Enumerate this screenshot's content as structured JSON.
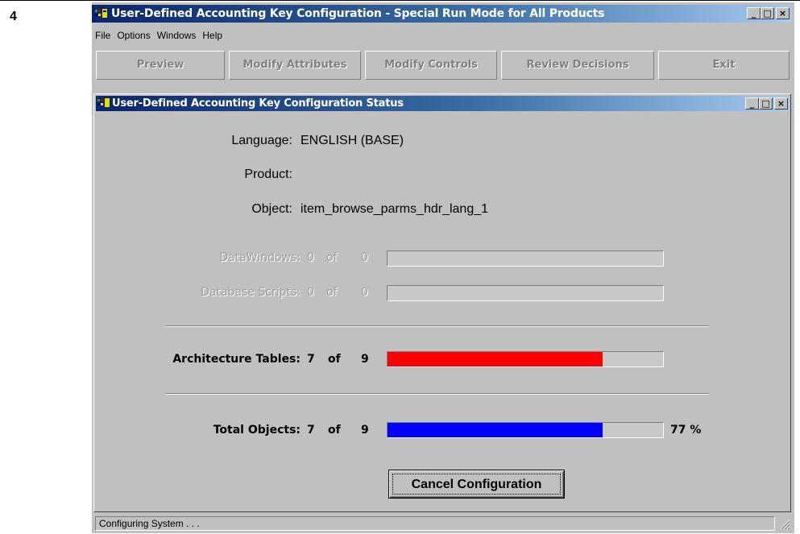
{
  "step_number": "4",
  "app": {
    "title": "User-Defined Accounting Key Configuration - Special Run Mode for All Products",
    "menu": [
      "File",
      "Options",
      "Windows",
      "Help"
    ],
    "toolbar": [
      "Preview",
      "Modify Attributes",
      "Modify Controls",
      "Review Decisions",
      "Exit"
    ],
    "window_controls": {
      "minimize": "_",
      "maximize": "□",
      "close": "×"
    }
  },
  "status_window": {
    "title": "User-Defined Accounting Key Configuration Status",
    "language_label": "Language:",
    "language_value": "ENGLISH  (BASE)",
    "product_label": "Product:",
    "product_value": "",
    "object_label": "Object:",
    "object_value": "item_browse_parms_hdr_lang_1",
    "rows": [
      {
        "label": "DataWindows:",
        "count": "0",
        "of": "of",
        "total": "0",
        "progress": 0,
        "enabled": false
      },
      {
        "label": "Database Scripts:",
        "count": "0",
        "of": "of",
        "total": "0",
        "progress": 0,
        "enabled": false
      },
      {
        "label": "Architecture Tables:",
        "count": "7",
        "of": "of",
        "total": "9",
        "progress": 0.78,
        "color": "#ff0000",
        "enabled": true
      },
      {
        "label": "Total Objects:",
        "count": "7",
        "of": "of",
        "total": "9",
        "progress": 0.78,
        "color": "#0000ff",
        "enabled": true,
        "percent": "77 %"
      }
    ],
    "cancel_button": "Cancel Configuration"
  },
  "statusbar": {
    "text": "Configuring System . . ."
  },
  "colors": {
    "titlebar_start": "#0a246a",
    "titlebar_end": "#a6caf0",
    "face": "#c0c0c0"
  }
}
